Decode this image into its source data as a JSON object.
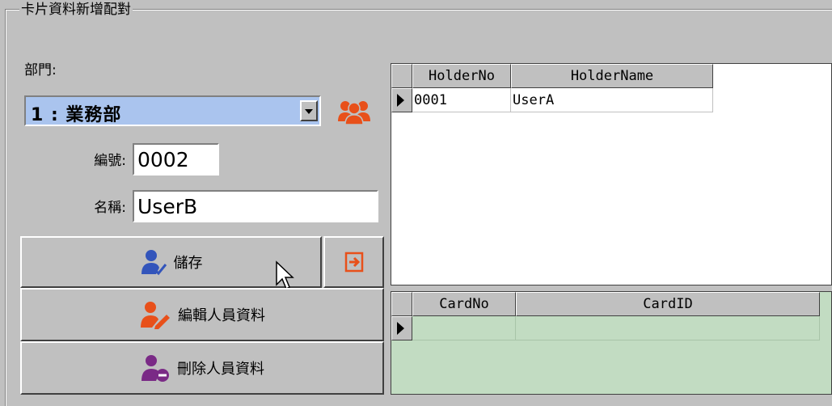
{
  "group": {
    "title": "卡片資料新增配對"
  },
  "department": {
    "label": "部門:",
    "selected": "1 : 業務部"
  },
  "form": {
    "number_label": "編號:",
    "number_value": "0002",
    "name_label": "名稱:",
    "name_value": "UserB"
  },
  "buttons": {
    "save": "儲存",
    "edit": "編輯人員資料",
    "delete": "刪除人員資料"
  },
  "holders_grid": {
    "columns": [
      "HolderNo",
      "HolderName"
    ],
    "rows": [
      {
        "no": "0001",
        "name": "UserA"
      }
    ]
  },
  "cards_grid": {
    "columns": [
      "CardNo",
      "CardID"
    ],
    "rows": []
  },
  "colors": {
    "window_bg": "#c0c0c0",
    "combo_selected_bg": "#aac4ee",
    "card_grid_bg": "#c2dcc2",
    "icon_orange": "#e8501a",
    "icon_blue": "#3355bb",
    "icon_purple": "#7a2a86"
  }
}
